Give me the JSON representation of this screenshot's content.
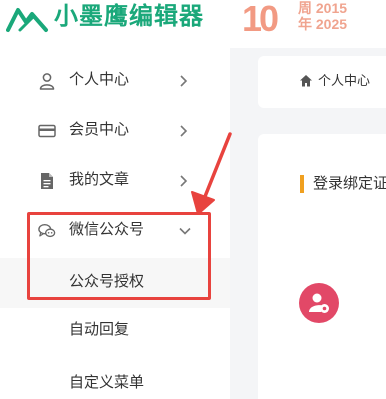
{
  "header": {
    "logo_text": "小墨鹰编辑器",
    "anniversary_number": "10",
    "anniversary_line1": "周 2015",
    "anniversary_line2": "年 2025"
  },
  "sidebar": {
    "items": [
      {
        "label": "个人中心",
        "icon": "user-icon"
      },
      {
        "label": "会员中心",
        "icon": "card-icon"
      },
      {
        "label": "我的文章",
        "icon": "document-icon"
      },
      {
        "label": "微信公众号",
        "icon": "chat-icon",
        "expanded": true
      }
    ],
    "subitems": [
      {
        "label": "公众号授权",
        "active": true
      },
      {
        "label": "自动回复"
      },
      {
        "label": "自定义菜单"
      }
    ]
  },
  "breadcrumb": {
    "text": "个人中心"
  },
  "content": {
    "section_title": "登录绑定证"
  },
  "colors": {
    "brand_green": "#1aa87a",
    "anniversary": "#f29a83",
    "highlight": "#e8433e",
    "title_bar": "#f0a020",
    "avatar": "#e24867"
  }
}
